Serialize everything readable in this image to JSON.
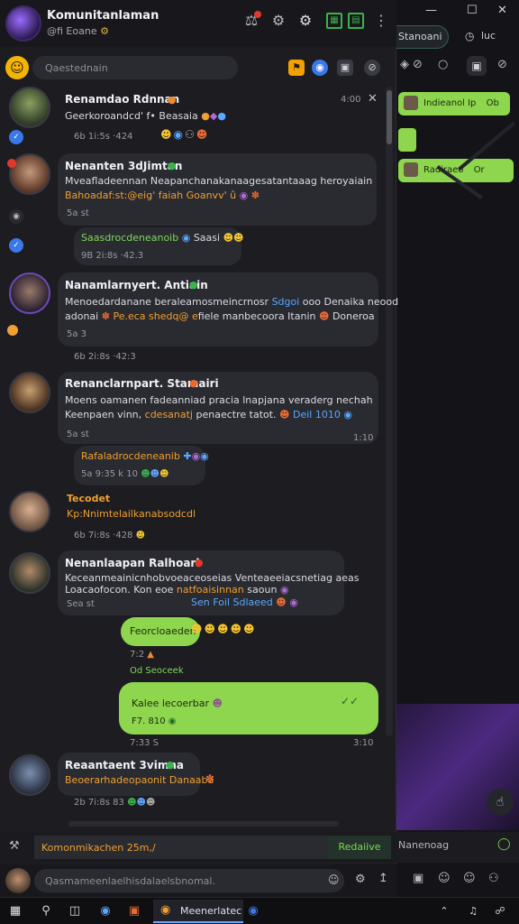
{
  "app": {
    "title": "Komunitanlaman",
    "subtitle": "@fi Eoane",
    "search_placeholder": "Qaestednain"
  },
  "messages": [
    {
      "name": "Renamdao Rdnnan",
      "line1": "Geerkoroandcd' f• Beasaia",
      "meta": "6b   1i:5s  ·424",
      "time": "4:00"
    },
    {
      "name": "Nenanten 3dJimtan",
      "line1": "Mveafladeennan Neapanchanakanaagesatantaaag heroyaiain",
      "line2": "Bahoadaf:st:@eig' faiah Goanvv' û",
      "meta": "5a st",
      "reply_name": "Saasdrocdeneanoib",
      "reply_tail": "Saasi",
      "reply_meta": "9B  2i:8s  ·42.3"
    },
    {
      "name": "Nanamlarnyert. Antiain",
      "line1a": "Menoedardanane beraleamosmeincrnosr",
      "line1b": "Sdgoi",
      "line1c": "ooo Denaika neood",
      "line2a": "adonai",
      "line2b": "Pe.eca shedq@ e",
      "line2c": "fiele manbecoora Itanin",
      "line2d": "Doneroa",
      "meta": "5a 3",
      "meta2": "6b   2i:8s  ·42:3"
    },
    {
      "name": "Renanclarnpart. Stamairi",
      "line1": "Moens oamanen fadeanniad pracia lnapjana veraderg nechah",
      "line2a": "Keenpaen vinn,",
      "line2b": "cdesanatj",
      "line2c": "penaectre tatot.",
      "line2d": "Deil 1010",
      "meta": "5a st",
      "time": "1:10",
      "reply_name": "Rafaladrocdeneanib",
      "reply_meta": "5a  9:35  k 10"
    },
    {
      "name": "Tecodet",
      "line1": "Kp:Nnimtelailkanabsodcdl",
      "meta": "6b   7i:8s  ·428"
    },
    {
      "name": "Nenanlaapan Ralhoarl",
      "line1": "Keceanmeainicnhobvoeaceoseias Venteaeeiacsnetiag aeas",
      "line2a": "Loacaofocon. Kon eoe",
      "line2b": "natfoaisinnan",
      "line2c": "saoun",
      "line3a": "Sea st",
      "line3b": "Sen Foil Sdlaeed"
    }
  ],
  "outgoing": [
    {
      "text": "Feorcloaeden",
      "meta": "7:2",
      "meta2": "Od   Seoceek"
    },
    {
      "text": "Kalee lecoerbar",
      "meta": "F7. 810",
      "time_l": "7:33 S",
      "time_r": "3:10"
    }
  ],
  "last_message": {
    "name": "Reaantaent 3vimna",
    "line1": "Beoerarhadeopaonit Danaaba",
    "meta": "2b   7i:8s   83"
  },
  "composer": {
    "draft": "Komonmikachen 25m,/",
    "send_label": "Redaiive",
    "placeholder": "Qasmameenlaelhisdalaelsbnomal."
  },
  "bg_window": {
    "tab_label": "Stanoani",
    "tab2_label": "luc",
    "pill1": "Indieanol Ip",
    "pill1_tail": "Ob",
    "pill2": "Radiraeo",
    "pill2_tail": "Or",
    "input_placeholder": "Nanenoag"
  },
  "taskbar": {
    "active_label": "Meenerlatec"
  }
}
